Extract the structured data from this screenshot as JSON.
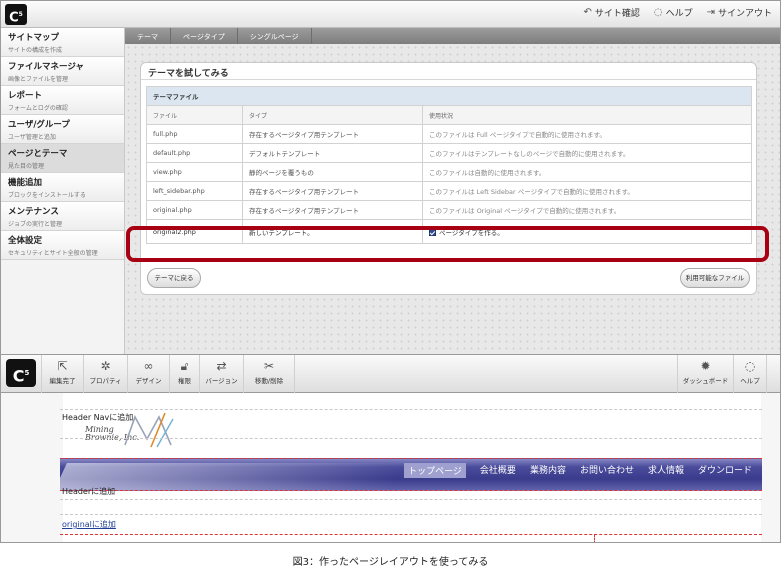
{
  "topbar": {
    "logo": "C",
    "logo_sup": "5",
    "site_check": "サイト確認",
    "help": "ヘルプ",
    "signout": "サインアウト"
  },
  "sidebar": {
    "items": [
      {
        "title": "サイトマップ",
        "sub": "サイトの構成を作成"
      },
      {
        "title": "ファイルマネージャ",
        "sub": "画像とファイルを管理"
      },
      {
        "title": "レポート",
        "sub": "フォームとログの確認"
      },
      {
        "title": "ユーザ/グループ",
        "sub": "ユーザ管理と追加"
      },
      {
        "title": "ページとテーマ",
        "sub": "見た目の管理"
      },
      {
        "title": "機能追加",
        "sub": "ブロックをインストールする"
      },
      {
        "title": "メンテナンス",
        "sub": "ジョブの実行と管理"
      },
      {
        "title": "全体設定",
        "sub": "セキュリティとサイト全般の管理"
      }
    ]
  },
  "subtabs": [
    "テーマ",
    "ページタイプ",
    "シングルページ"
  ],
  "panel": {
    "title": "テーマを試してみる",
    "table_caption": "テーマファイル",
    "headers": [
      "ファイル",
      "タイプ",
      "使用状況"
    ],
    "rows": [
      [
        "full.php",
        "存在するページタイプ用テンプレート",
        "このファイルは Full ページタイプで自動的に使用されます。"
      ],
      [
        "default.php",
        "デフォルトテンプレート",
        "このファイルはテンプレートなしのページで自動的に使用されます。"
      ],
      [
        "view.php",
        "静的ページを覆うもの",
        "このファイルは自動的に使用されます。"
      ],
      [
        "left_sidebar.php",
        "存在するページタイプ用テンプレート",
        "このファイルは Left Sidebar ページタイプで自動的に使用されます。"
      ],
      [
        "original.php",
        "存在するページタイプ用テンプレート",
        "このファイルは Original ページタイプで自動的に使用されます。"
      ]
    ],
    "highlight_row": {
      "file": "original2.php",
      "type": "新しいテンプレート。",
      "usage": "ページタイプを作る。",
      "checked": true
    },
    "back_button": "テーマに戻る",
    "files_button": "利用可能なファイル"
  },
  "toolbar": {
    "logo": "C",
    "logo_sup": "5",
    "tools": [
      {
        "label": "編集完了",
        "icon": "exit-edit-icon"
      },
      {
        "label": "プロパティ",
        "icon": "gear-icon"
      },
      {
        "label": "デザイン",
        "icon": "glasses-icon"
      },
      {
        "label": "権限",
        "icon": "lock-icon"
      },
      {
        "label": "バージョン",
        "icon": "versions-icon"
      },
      {
        "label": "移動/削除",
        "icon": "scissors-icon"
      }
    ],
    "right_tools": [
      {
        "label": "ダッシュボード",
        "icon": "dashboard-icon"
      },
      {
        "label": "ヘルプ",
        "icon": "help-icon"
      }
    ]
  },
  "preview": {
    "header_nav_label": "Header Navに追加",
    "brand_line1": "Mining",
    "brand_line2": "Brownie, Inc.",
    "nav_items": [
      "トップページ",
      "会社概要",
      "業務内容",
      "お問い合わせ",
      "求人情報",
      "ダウンロード"
    ],
    "header_label": "Headerに追加",
    "original_link": "originalに追加"
  },
  "caption": "図3：作ったページレイアウトを使ってみる",
  "colors": {
    "highlight_border": "#a80012",
    "nav_band": "#3a3b8c",
    "table_caption_bg": "#dbe6f1"
  }
}
